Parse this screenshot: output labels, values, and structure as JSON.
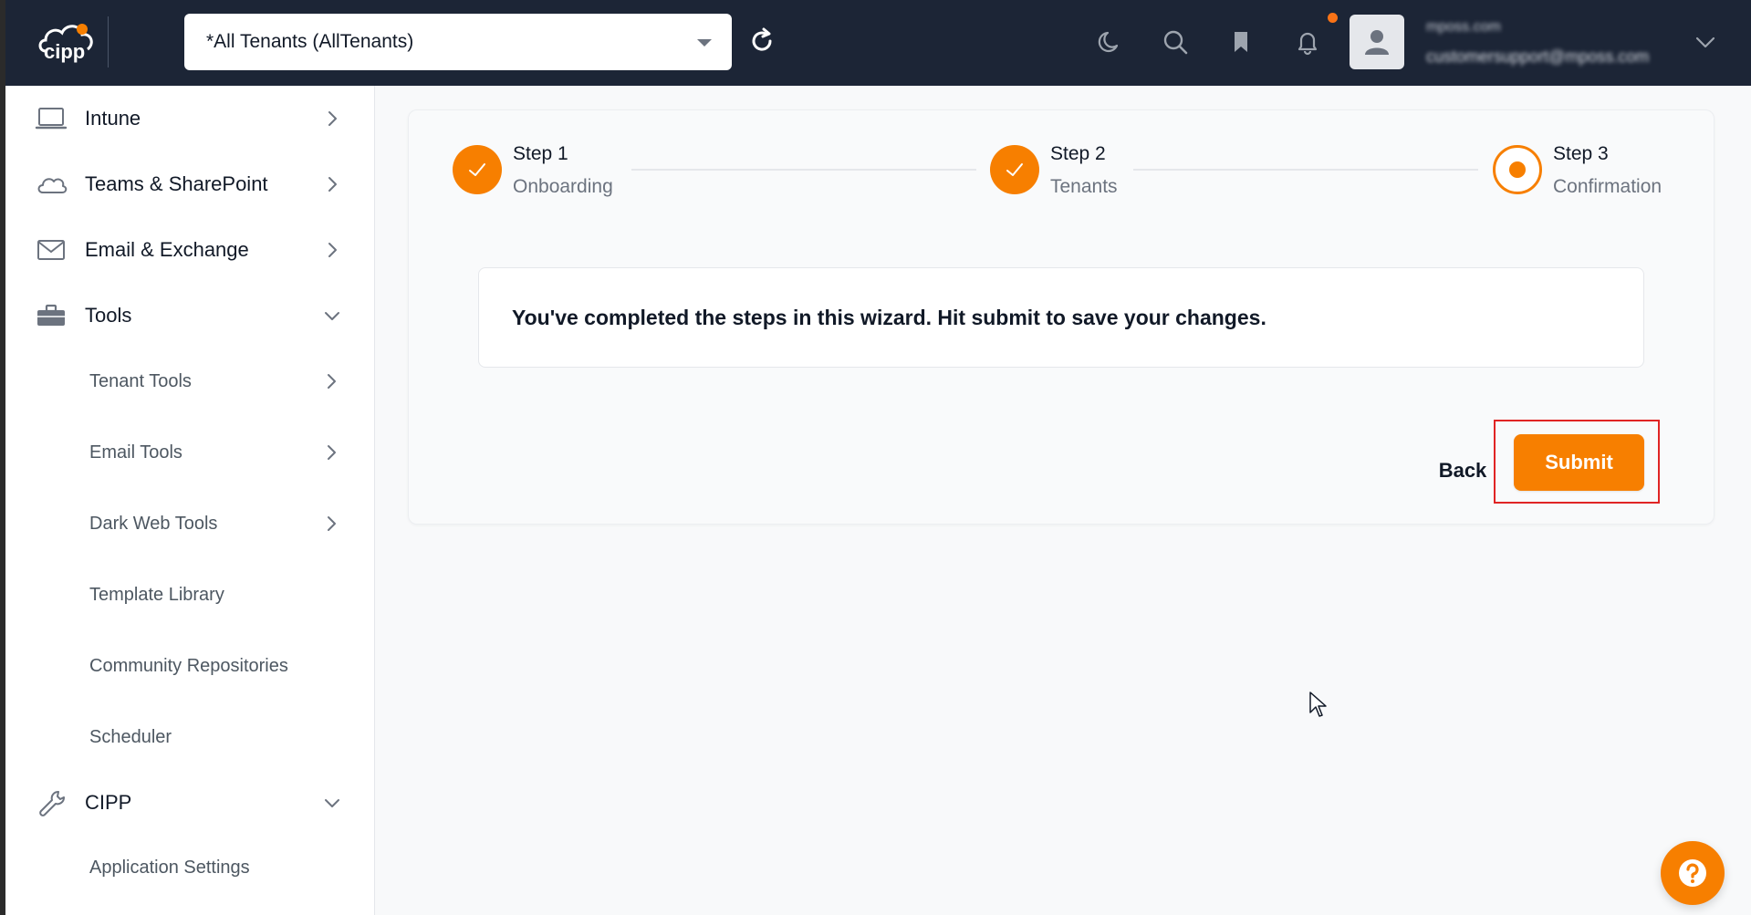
{
  "header": {
    "tenant_selector": "*All Tenants (AllTenants)",
    "user_name": "mposs.com",
    "user_email": "customersupport@mposs.com"
  },
  "sidebar": {
    "items": [
      {
        "label": "Intune",
        "icon": "laptop-icon",
        "state": "collapsed"
      },
      {
        "label": "Teams & SharePoint",
        "icon": "cloud-icon",
        "state": "collapsed"
      },
      {
        "label": "Email & Exchange",
        "icon": "mail-icon",
        "state": "collapsed"
      },
      {
        "label": "Tools",
        "icon": "toolbox-icon",
        "state": "expanded"
      },
      {
        "label": "CIPP",
        "icon": "wrench-icon",
        "state": "expanded"
      }
    ],
    "tools_sub": [
      {
        "label": "Tenant Tools"
      },
      {
        "label": "Email Tools"
      },
      {
        "label": "Dark Web Tools"
      },
      {
        "label": "Template Library"
      },
      {
        "label": "Community Repositories"
      },
      {
        "label": "Scheduler"
      }
    ],
    "cipp_sub": [
      {
        "label": "Application Settings"
      }
    ]
  },
  "wizard": {
    "steps": [
      {
        "title": "Step 1",
        "subtitle": "Onboarding",
        "status": "complete"
      },
      {
        "title": "Step 2",
        "subtitle": "Tenants",
        "status": "complete"
      },
      {
        "title": "Step 3",
        "subtitle": "Confirmation",
        "status": "active"
      }
    ],
    "message": "You've completed the steps in this wizard. Hit submit to save your changes.",
    "back_label": "Back",
    "submit_label": "Submit"
  },
  "colors": {
    "accent": "#f77f00",
    "topbar": "#1c2536",
    "highlight": "#e02424"
  }
}
